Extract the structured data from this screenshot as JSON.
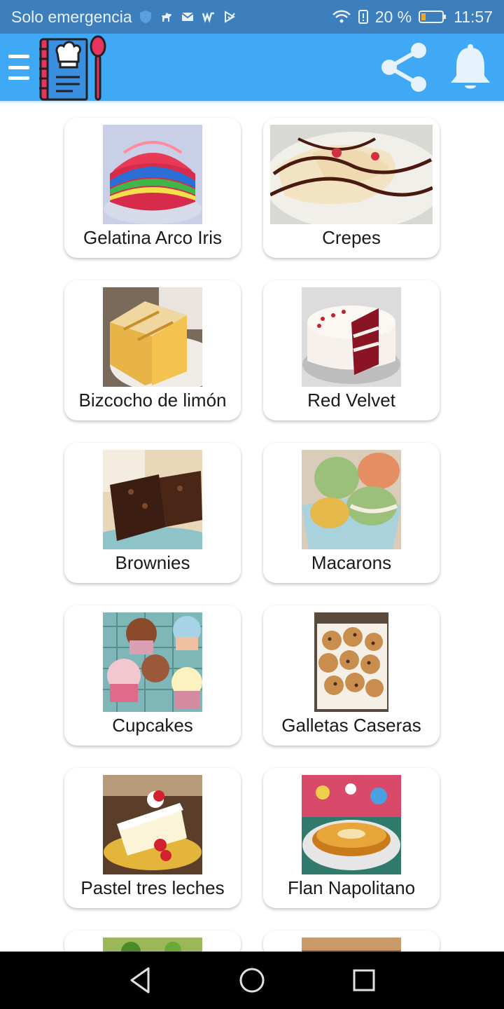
{
  "status_bar": {
    "carrier": "Solo emergencia",
    "battery_percent": "20 %",
    "battery_level": 0.2,
    "time": "11:57"
  },
  "app_bar": {
    "logo_icon": "cookbook-icon",
    "share_icon": "share-icon",
    "bell_icon": "bell-icon",
    "background": "#3fa9f5"
  },
  "recipes": [
    {
      "name": "Gelatina Arco Iris",
      "image": "rainbow-jelly"
    },
    {
      "name": "Crepes",
      "image": "crepes"
    },
    {
      "name": "Bizcocho de limón",
      "image": "lemon-cake"
    },
    {
      "name": "Red Velvet",
      "image": "red-velvet-cake"
    },
    {
      "name": "Brownies",
      "image": "brownies"
    },
    {
      "name": "Macarons",
      "image": "macarons"
    },
    {
      "name": "Cupcakes",
      "image": "cupcakes"
    },
    {
      "name": "Galletas Caseras",
      "image": "cookies"
    },
    {
      "name": "Pastel tres leches",
      "image": "tres-leches-cake"
    },
    {
      "name": "Flan Napolitano",
      "image": "flan"
    }
  ],
  "nav_bar": {
    "back_icon": "back-icon",
    "home_icon": "home-icon",
    "recents_icon": "recents-icon"
  }
}
